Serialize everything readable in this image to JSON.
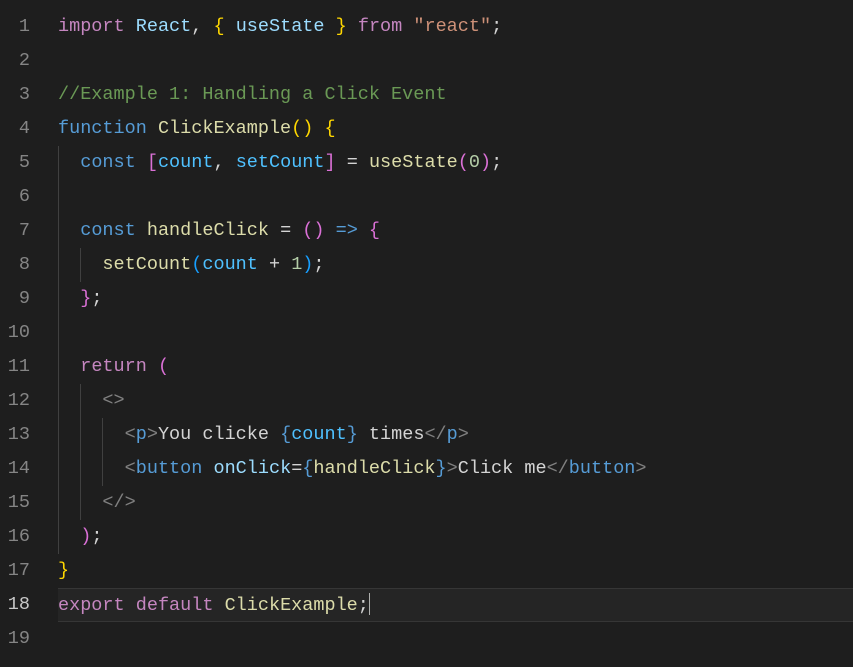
{
  "gutter": {
    "lines": [
      "1",
      "2",
      "3",
      "4",
      "5",
      "6",
      "7",
      "8",
      "9",
      "10",
      "11",
      "12",
      "13",
      "14",
      "15",
      "16",
      "17",
      "18",
      "19"
    ],
    "activeLine": 18
  },
  "code": {
    "l1": {
      "import": "import",
      "react": "React",
      "comma": ", ",
      "lbrace": "{",
      "sp1": " ",
      "useState": "useState",
      "sp2": " ",
      "rbrace": "}",
      "from": " from ",
      "str": "\"react\"",
      "semi": ";"
    },
    "l3": {
      "comment": "//Example 1: Handling a Click Event"
    },
    "l4": {
      "function": "function",
      "sp": " ",
      "name": "ClickExample",
      "lp": "(",
      "rp": ")",
      "sp2": " ",
      "lb": "{"
    },
    "l5": {
      "indent": "  ",
      "const": "const",
      "sp1": " ",
      "lb": "[",
      "count": "count",
      "comma": ", ",
      "setCount": "setCount",
      "rb": "]",
      "eq": " = ",
      "useState": "useState",
      "lp": "(",
      "zero": "0",
      "rp": ")",
      "semi": ";"
    },
    "l7": {
      "indent": "  ",
      "const": "const",
      "sp": " ",
      "name": "handleClick",
      "eq": " = ",
      "lp": "(",
      "rp": ")",
      "arrow": " => ",
      "lb": "{"
    },
    "l8": {
      "indent": "    ",
      "setCount": "setCount",
      "lp": "(",
      "count": "count",
      "plus": " + ",
      "one": "1",
      "rp": ")",
      "semi": ";"
    },
    "l9": {
      "indent": "  ",
      "rb": "}",
      "semi": ";"
    },
    "l11": {
      "indent": "  ",
      "return": "return",
      "sp": " ",
      "lp": "("
    },
    "l12": {
      "indent": "    ",
      "open": "<>"
    },
    "l13": {
      "indent": "      ",
      "open": "<",
      "p1": "p",
      "close1": ">",
      "text1": "You clicke ",
      "lb": "{",
      "count": "count",
      "rb": "}",
      "text2": " times",
      "open2": "</",
      "p2": "p",
      "close2": ">"
    },
    "l14": {
      "indent": "      ",
      "open": "<",
      "button1": "button",
      "sp": " ",
      "onClick": "onClick",
      "eq": "=",
      "lb": "{",
      "handle": "handleClick",
      "rb": "}",
      "close1": ">",
      "text": "Click me",
      "open2": "</",
      "button2": "button",
      "close2": ">"
    },
    "l15": {
      "indent": "    ",
      "close": "</>"
    },
    "l16": {
      "indent": "  ",
      "rp": ")",
      "semi": ";"
    },
    "l17": {
      "rb": "}"
    },
    "l18": {
      "export": "export",
      "sp1": " ",
      "default": "default",
      "sp2": " ",
      "name": "ClickExample",
      "semi": ";"
    }
  }
}
